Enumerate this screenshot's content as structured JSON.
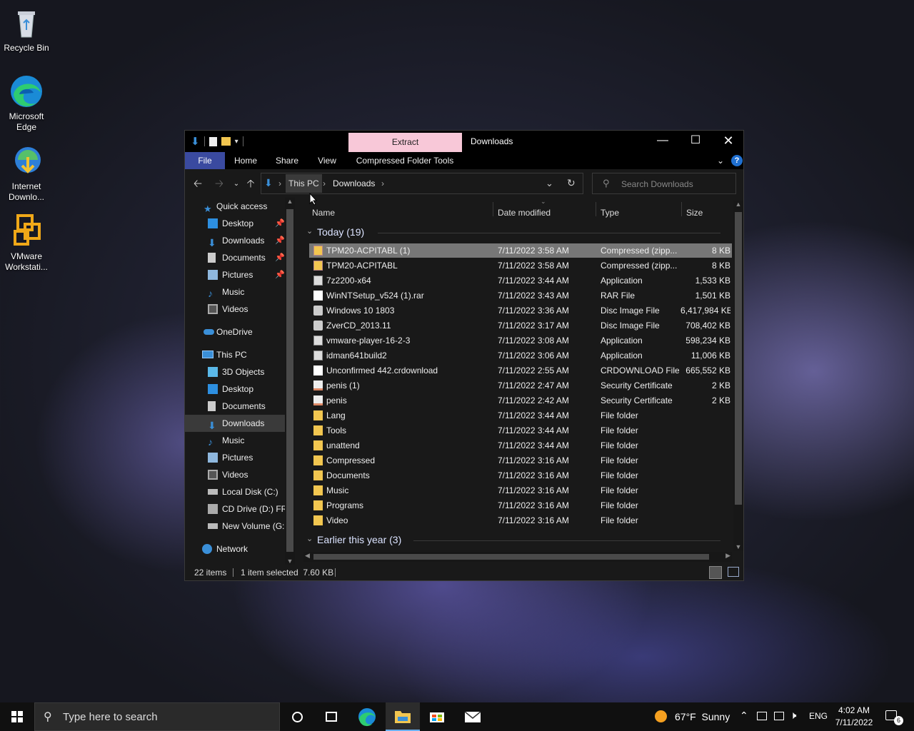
{
  "desktop": {
    "icons": [
      {
        "label": "Recycle Bin"
      },
      {
        "label": "Microsoft Edge"
      },
      {
        "label": "Internet Downlo..."
      },
      {
        "label": "VMware Workstati..."
      }
    ]
  },
  "window": {
    "title": "Downloads",
    "contextual_tab": "Extract",
    "ribbon_tabs": [
      "File",
      "Home",
      "Share",
      "View",
      "Compressed Folder Tools"
    ],
    "breadcrumb": [
      "This PC",
      "Downloads"
    ],
    "search_placeholder": "Search Downloads",
    "nav": {
      "quick_access": "Quick access",
      "quick_items": [
        "Desktop",
        "Downloads",
        "Documents",
        "Pictures",
        "Music",
        "Videos"
      ],
      "onedrive": "OneDrive",
      "this_pc": "This PC",
      "pc_items": [
        "3D Objects",
        "Desktop",
        "Documents",
        "Downloads",
        "Music",
        "Pictures",
        "Videos",
        "Local Disk (C:)",
        "CD Drive (D:) FR",
        "New Volume (G:"
      ],
      "network": "Network"
    },
    "columns": [
      "Name",
      "Date modified",
      "Type",
      "Size"
    ],
    "group_today": "Today (19)",
    "group_earlier": "Earlier this year (3)",
    "files": [
      {
        "name": "TPM20-ACPITABL (1)",
        "date": "7/11/2022 3:58 AM",
        "type": "Compressed (zipp...",
        "size": "8 KB",
        "icon": "zip-icon"
      },
      {
        "name": "TPM20-ACPITABL",
        "date": "7/11/2022 3:58 AM",
        "type": "Compressed (zipp...",
        "size": "8 KB",
        "icon": "zip-icon"
      },
      {
        "name": "7z2200-x64",
        "date": "7/11/2022 3:44 AM",
        "type": "Application",
        "size": "1,533 KB",
        "icon": "app-icon"
      },
      {
        "name": "WinNTSetup_v524 (1).rar",
        "date": "7/11/2022 3:43 AM",
        "type": "RAR File",
        "size": "1,501 KB",
        "icon": "file-icon"
      },
      {
        "name": "Windows 10 1803",
        "date": "7/11/2022 3:36 AM",
        "type": "Disc Image File",
        "size": "6,417,984 KB",
        "icon": "disc-icon"
      },
      {
        "name": "ZverCD_2013.11",
        "date": "7/11/2022 3:17 AM",
        "type": "Disc Image File",
        "size": "708,402 KB",
        "icon": "disc-icon"
      },
      {
        "name": "vmware-player-16-2-3",
        "date": "7/11/2022 3:08 AM",
        "type": "Application",
        "size": "598,234 KB",
        "icon": "app-icon"
      },
      {
        "name": "idman641build2",
        "date": "7/11/2022 3:06 AM",
        "type": "Application",
        "size": "11,006 KB",
        "icon": "app-icon"
      },
      {
        "name": "Unconfirmed 442.crdownload",
        "date": "7/11/2022 2:55 AM",
        "type": "CRDOWNLOAD File",
        "size": "665,552 KB",
        "icon": "file-icon"
      },
      {
        "name": "penis (1)",
        "date": "7/11/2022 2:47 AM",
        "type": "Security Certificate",
        "size": "2 KB",
        "icon": "cert-icon"
      },
      {
        "name": "penis",
        "date": "7/11/2022 2:42 AM",
        "type": "Security Certificate",
        "size": "2 KB",
        "icon": "cert-icon"
      },
      {
        "name": "Lang",
        "date": "7/11/2022 3:44 AM",
        "type": "File folder",
        "size": "",
        "icon": "folder-icon"
      },
      {
        "name": "Tools",
        "date": "7/11/2022 3:44 AM",
        "type": "File folder",
        "size": "",
        "icon": "folder-icon"
      },
      {
        "name": "unattend",
        "date": "7/11/2022 3:44 AM",
        "type": "File folder",
        "size": "",
        "icon": "folder-icon"
      },
      {
        "name": "Compressed",
        "date": "7/11/2022 3:16 AM",
        "type": "File folder",
        "size": "",
        "icon": "folder-icon"
      },
      {
        "name": "Documents",
        "date": "7/11/2022 3:16 AM",
        "type": "File folder",
        "size": "",
        "icon": "folder-icon"
      },
      {
        "name": "Music",
        "date": "7/11/2022 3:16 AM",
        "type": "File folder",
        "size": "",
        "icon": "folder-icon"
      },
      {
        "name": "Programs",
        "date": "7/11/2022 3:16 AM",
        "type": "File folder",
        "size": "",
        "icon": "folder-icon"
      },
      {
        "name": "Video",
        "date": "7/11/2022 3:16 AM",
        "type": "File folder",
        "size": "",
        "icon": "folder-icon"
      }
    ],
    "status": {
      "count": "22 items",
      "selection": "1 item selected  7.60 KB"
    }
  },
  "taskbar": {
    "search_placeholder": "Type here to search",
    "weather": "67°F  Sunny",
    "language": "ENG",
    "time": "4:02 AM",
    "date": "7/11/2022",
    "notifications": "6"
  }
}
